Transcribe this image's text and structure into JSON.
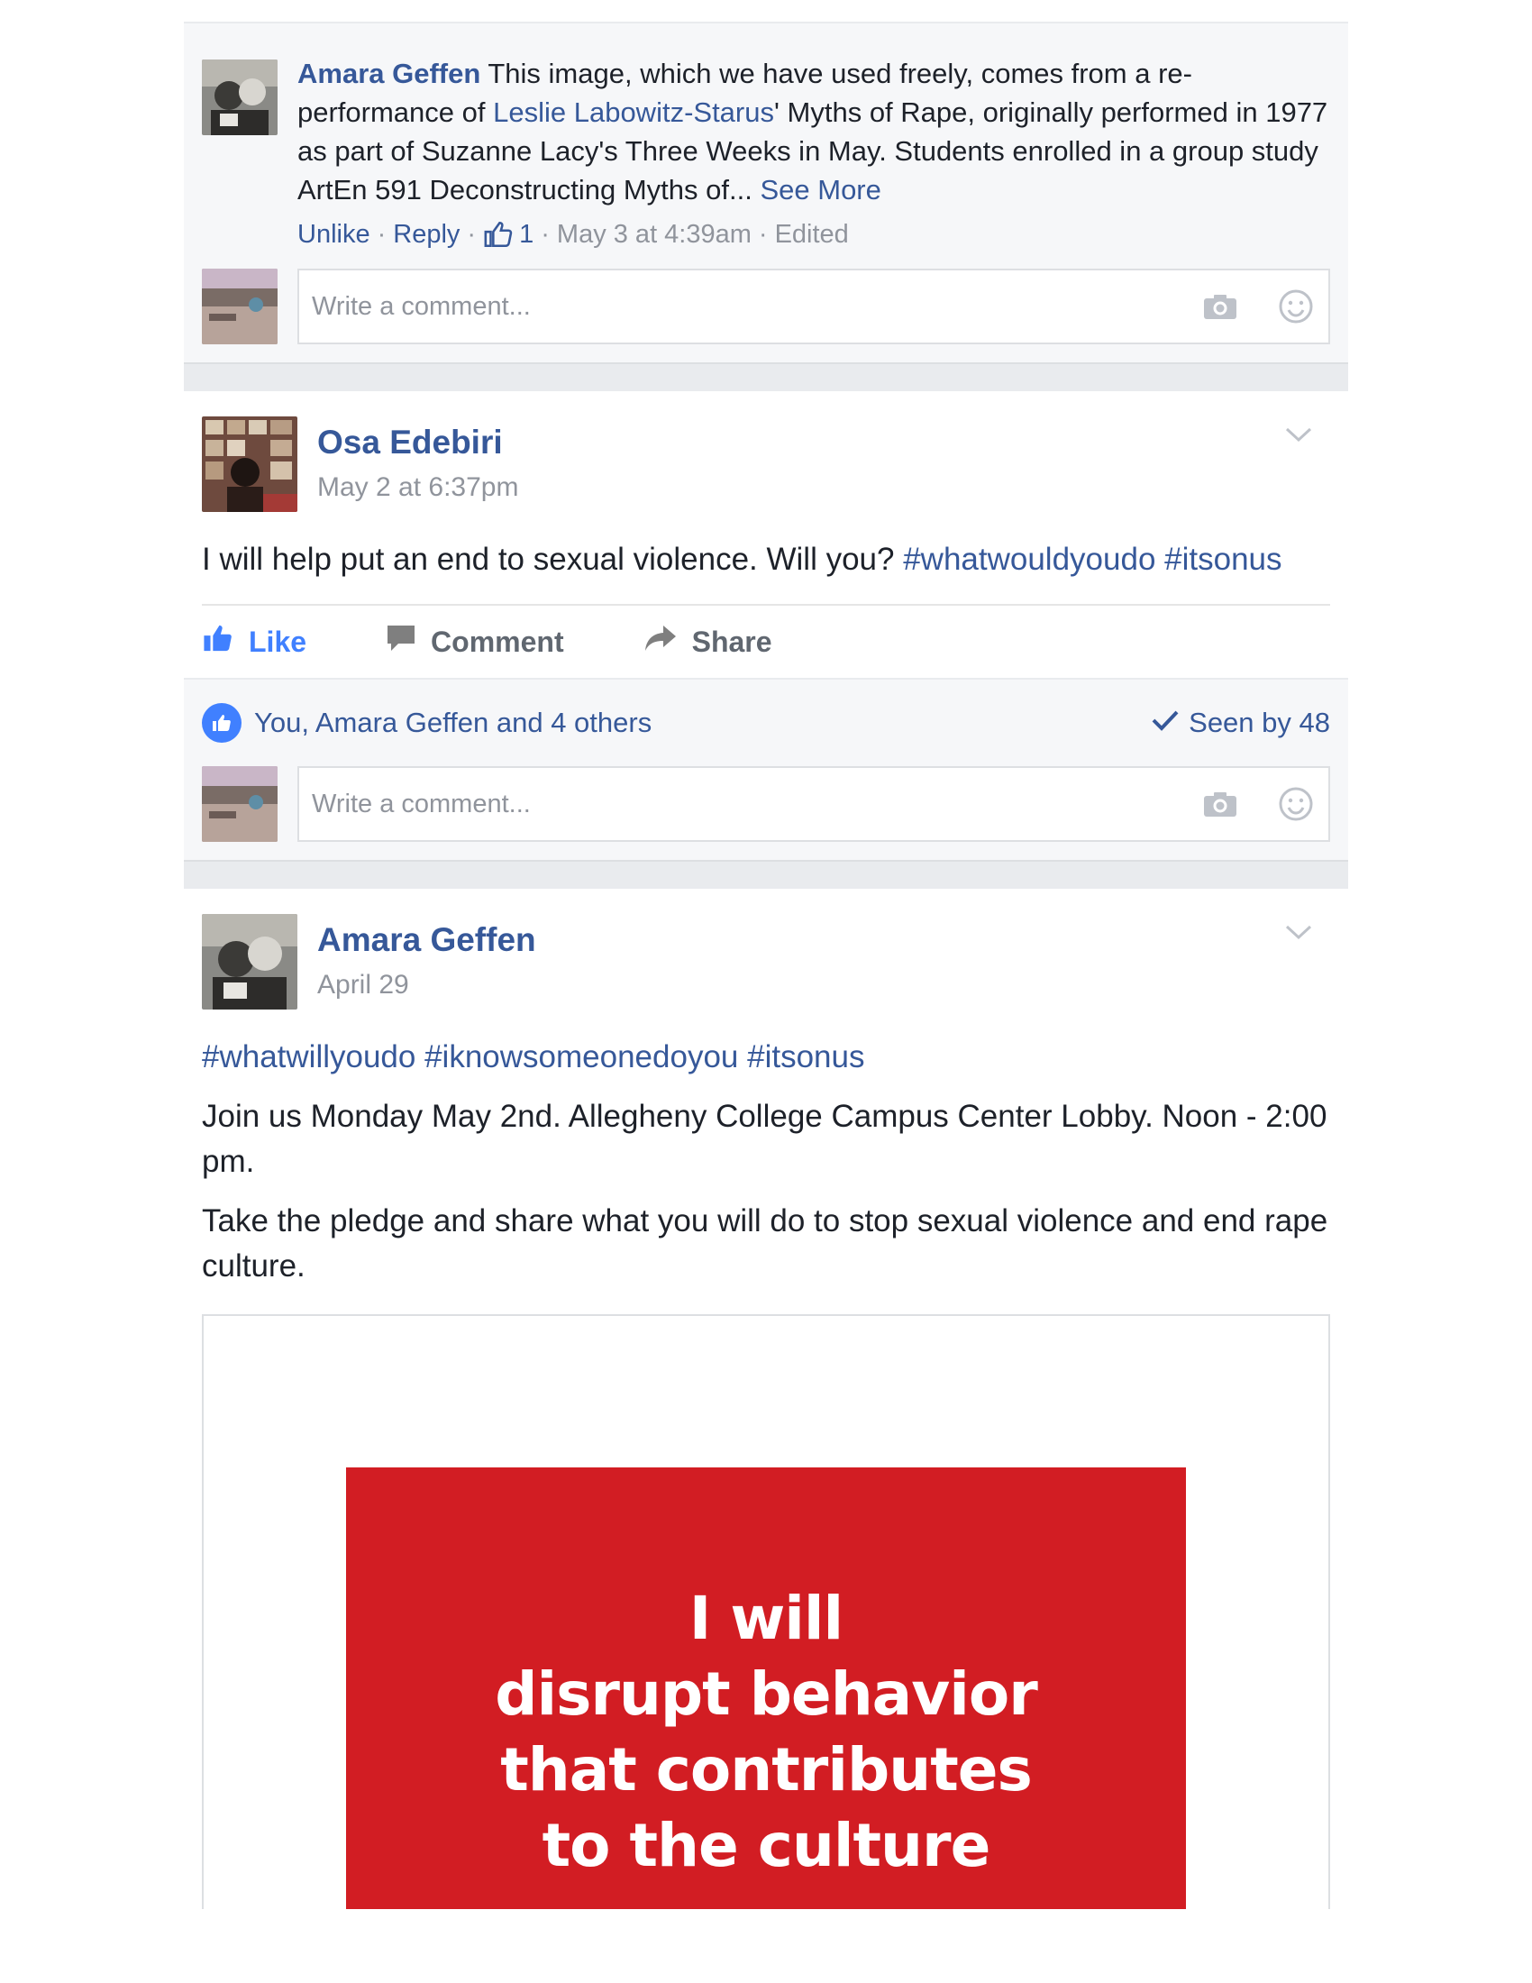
{
  "top_comment": {
    "author": "Amara Geffen",
    "text_part1": "This image, which we have used freely, comes from a re-performance of ",
    "link_text": "Leslie Labowitz-Starus",
    "text_part2": "' Myths of Rape, originally performed in 1977 as part of Suzanne Lacy's Three Weeks in May. Students enrolled in a group study ArtEn 591 Deconstructing Myths of...",
    "see_more": "See More",
    "unlike": "Unlike",
    "reply": "Reply",
    "like_count": "1",
    "timestamp": "May 3 at 4:39am",
    "edited": "Edited"
  },
  "write_comment": {
    "placeholder": "Write a comment..."
  },
  "post1": {
    "author": "Osa Edebiri",
    "time": "May 2 at 6:37pm",
    "text": "I will help put an end to sexual violence. Will you? ",
    "hashtag1": "#whatwouldyoudo",
    "hashtag2": "#itsonus",
    "actions": {
      "like": "Like",
      "comment": "Comment",
      "share": "Share"
    },
    "reactions_text": "You, Amara Geffen and 4 others",
    "seen_by": "Seen by 48"
  },
  "post2": {
    "author": "Amara Geffen",
    "time": "April 29",
    "hashtags": "#whatwillyoudo #iknowsomeonedoyou #itsonus",
    "paragraph1": "Join us Monday May 2nd. Allegheny College Campus Center Lobby. Noon - 2:00 pm.",
    "paragraph2": "Take the pledge and share what you will do to stop sexual violence and end rape culture.",
    "image_text": [
      "I will",
      "disrupt behavior",
      "that contributes",
      "to the culture"
    ]
  },
  "colors": {
    "link": "#365899",
    "like_blue": "#4080ff",
    "poster_red": "#d21d23"
  },
  "icons": [
    "thumbs-up-icon",
    "camera-icon",
    "smiley-icon",
    "chevron-down-icon",
    "comment-icon",
    "share-icon",
    "check-icon"
  ]
}
